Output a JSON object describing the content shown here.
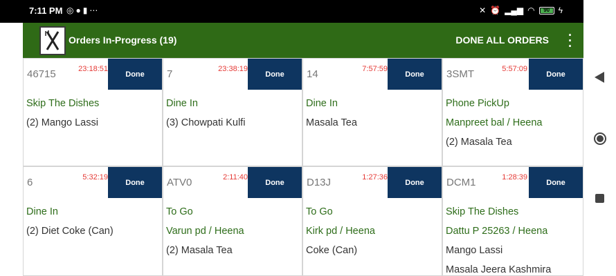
{
  "status": {
    "time": "7:11 PM",
    "battery": "90"
  },
  "toolbar": {
    "title": "Orders In-Progress  (19)",
    "done_all": "DONE ALL ORDERS"
  },
  "orders": [
    {
      "id": "46715",
      "timer": "23:18:51",
      "done": "Done",
      "lines": [
        {
          "text": "Skip The Dishes",
          "kind": "green"
        },
        {
          "text": "(2) Mango Lassi",
          "kind": "dark"
        }
      ]
    },
    {
      "id": "7",
      "timer": "23:38:19",
      "done": "Done",
      "lines": [
        {
          "text": "Dine In",
          "kind": "green"
        },
        {
          "text": "(3) Chowpati Kulfi",
          "kind": "dark"
        }
      ]
    },
    {
      "id": "14",
      "timer": "7:57:59",
      "done": "Done",
      "lines": [
        {
          "text": "Dine In",
          "kind": "green"
        },
        {
          "text": "Masala Tea",
          "kind": "dark"
        }
      ]
    },
    {
      "id": "3SMT",
      "timer": "5:57:09",
      "done": "Done",
      "lines": [
        {
          "text": "Phone PickUp",
          "kind": "green"
        },
        {
          "text": "Manpreet bal / Heena",
          "kind": "green"
        },
        {
          "text": "(2) Masala Tea",
          "kind": "dark"
        }
      ]
    },
    {
      "id": "6",
      "timer": "5:32:19",
      "done": "Done",
      "lines": [
        {
          "text": "Dine In",
          "kind": "green"
        },
        {
          "text": "(2) Diet Coke (Can)",
          "kind": "dark"
        }
      ]
    },
    {
      "id": "ATV0",
      "timer": "2:11:40",
      "done": "Done",
      "lines": [
        {
          "text": "To Go",
          "kind": "green"
        },
        {
          "text": "Varun pd / Heena",
          "kind": "green"
        },
        {
          "text": "(2) Masala Tea",
          "kind": "dark"
        }
      ]
    },
    {
      "id": "D13J",
      "timer": "1:27:36",
      "done": "Done",
      "lines": [
        {
          "text": "To Go",
          "kind": "green"
        },
        {
          "text": "Kirk pd / Heena",
          "kind": "green"
        },
        {
          "text": "Coke (Can)",
          "kind": "dark"
        }
      ]
    },
    {
      "id": "DCM1",
      "timer": "1:28:39",
      "done": "Done",
      "lines": [
        {
          "text": "Skip The Dishes",
          "kind": "green"
        },
        {
          "text": "Dattu P 25263 / Heena",
          "kind": "green"
        },
        {
          "text": "Mango Lassi",
          "kind": "dark"
        },
        {
          "text": "Masala Jeera Kashmira",
          "kind": "dark"
        }
      ]
    }
  ],
  "colors": {
    "toolbar": "#2f6a16",
    "done_button": "#0e3560",
    "timer": "#e53935",
    "service_text": "#2e6d1a"
  },
  "icons": {
    "logo": "fork-knife-logo-icon",
    "menu": "overflow-menu-icon",
    "nav_back": "nav-back-icon",
    "nav_home": "nav-home-icon",
    "nav_recents": "nav-recents-icon"
  }
}
